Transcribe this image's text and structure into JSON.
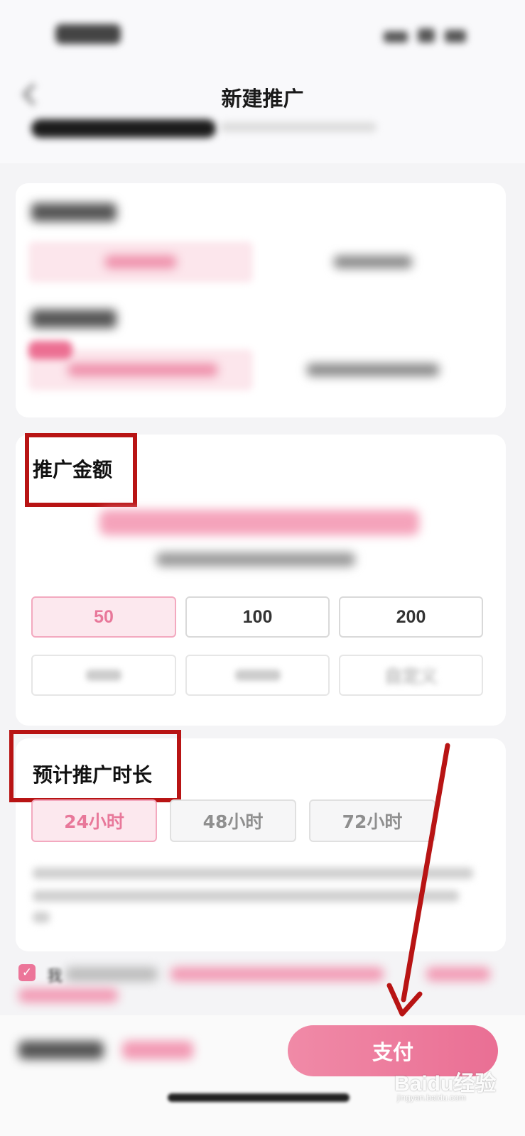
{
  "header": {
    "title": "新建推广"
  },
  "amount_section": {
    "title": "推广金额",
    "options": [
      "50",
      "100",
      "200"
    ],
    "faded_option": "自定义",
    "selected": "50"
  },
  "duration_section": {
    "title": "预计推广时长",
    "options": [
      "24小时",
      "48小时",
      "72小时"
    ],
    "selected": "24小时"
  },
  "agreement": {
    "checkbox_mark": "✓",
    "prefix": "我"
  },
  "footer": {
    "pay_label": "支付"
  },
  "watermark": {
    "brand": "Baidu经验",
    "url": "jingyan.baidu.com"
  },
  "colors": {
    "accent": "#ea6f94",
    "highlight_box": "#b81414",
    "arrow": "#b81414"
  }
}
